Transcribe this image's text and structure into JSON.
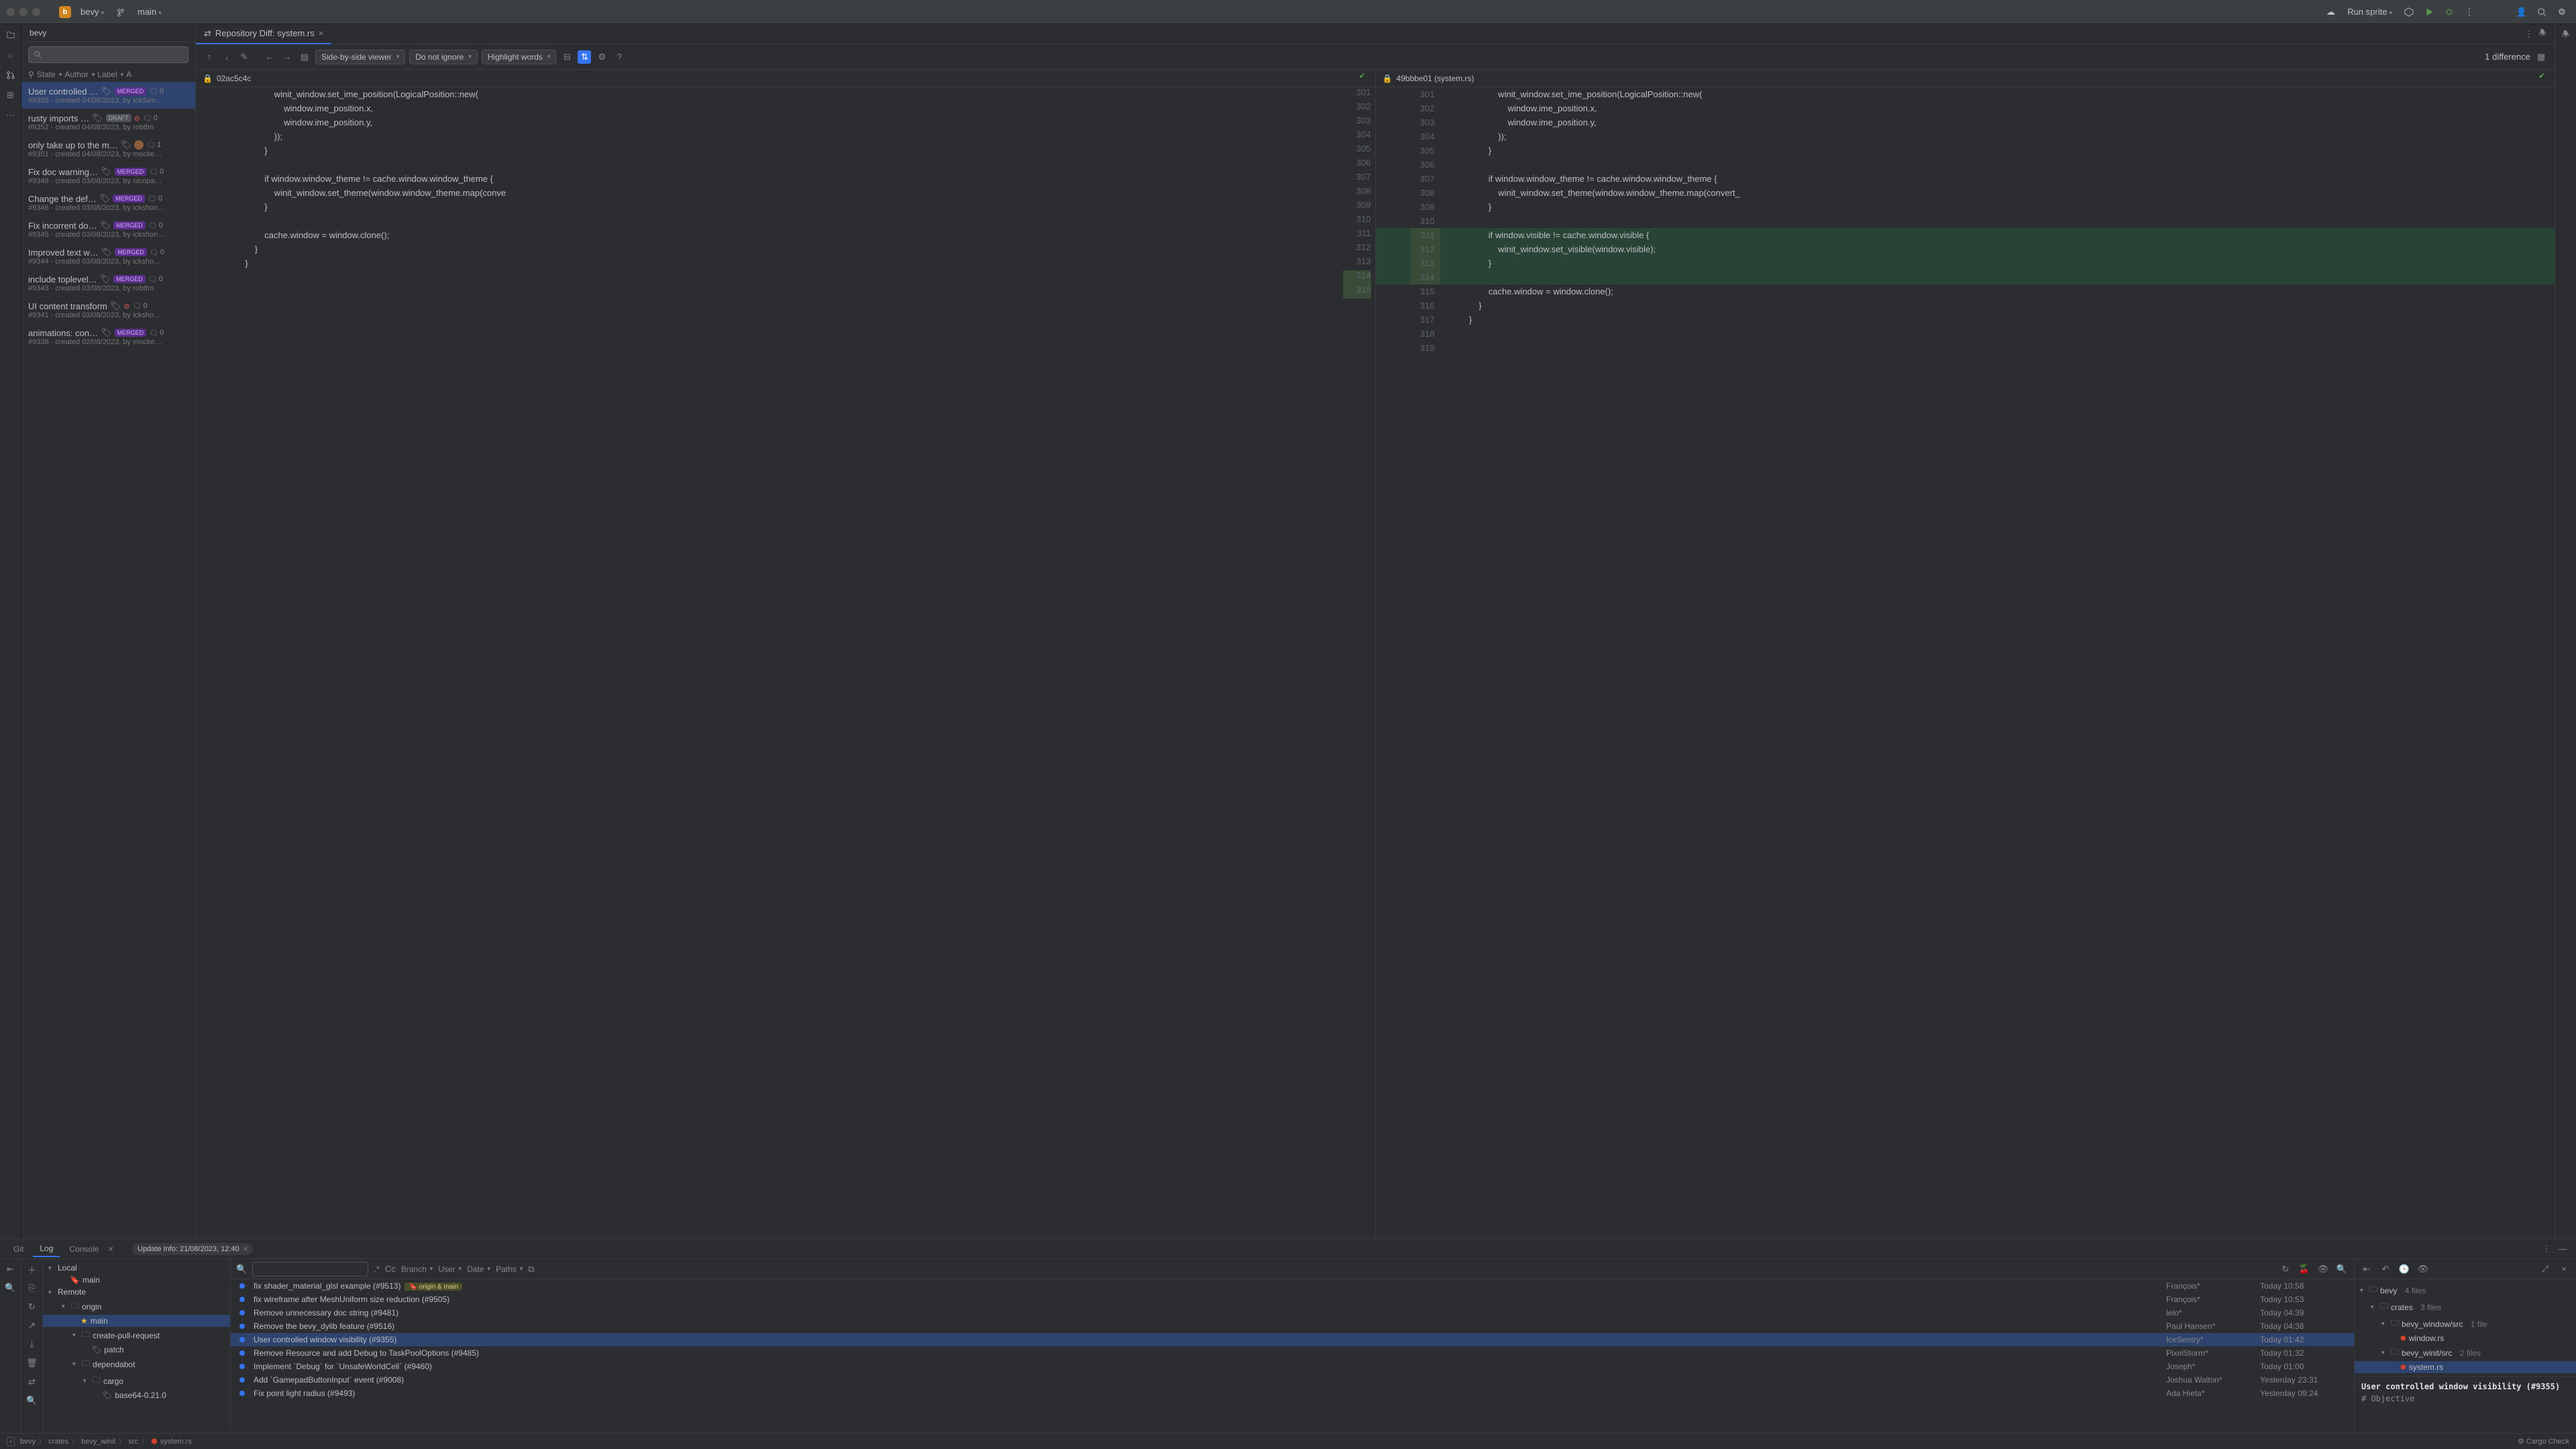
{
  "titlebar": {
    "project_initial": "b",
    "project_name": "bevy",
    "branch": "main",
    "run_config": "Run sprite"
  },
  "pr_panel": {
    "tab": "bevy",
    "search_placeholder": "",
    "filters": {
      "state": "State",
      "author": "Author",
      "label": "Label",
      "assignee": "A"
    },
    "items": [
      {
        "title": "User controlled …",
        "badge": "MERGED",
        "comments": "0",
        "meta": "#9355 · created 04/08/2023, by IceSen…",
        "sel": true
      },
      {
        "title": "rusty imports …",
        "badge": "DRAFT",
        "x": true,
        "comments": "0",
        "meta": "#9352 · created 04/08/2023, by robtfm"
      },
      {
        "title": "only take up to the m…",
        "badge": "",
        "avatar": true,
        "comments": "1",
        "meta": "#9351 · created 04/08/2023, by mocke…"
      },
      {
        "title": "Fix doc warning…",
        "badge": "MERGED",
        "comments": "0",
        "meta": "#9348 · created 03/08/2023, by nicopa…"
      },
      {
        "title": "Change the def…",
        "badge": "MERGED",
        "comments": "0",
        "meta": "#9346 · created 03/08/2023, by ickshon…"
      },
      {
        "title": "Fix incorrent do…",
        "badge": "MERGED",
        "comments": "0",
        "meta": "#9345 · created 03/08/2023, by ickshon…"
      },
      {
        "title": "Improved text w…",
        "badge": "MERGED",
        "comments": "0",
        "meta": "#9344 · created 03/08/2023, by icksho…"
      },
      {
        "title": "include toplevel…",
        "badge": "MERGED",
        "comments": "0",
        "meta": "#9343 · created 03/08/2023, by robtfm"
      },
      {
        "title": "UI content transform",
        "badge": "",
        "x": true,
        "comments": "0",
        "meta": "#9341 · created 03/08/2023, by icksho…"
      },
      {
        "title": "animations: con…",
        "badge": "MERGED",
        "comments": "0",
        "meta": "#9338 · created 02/08/2023, by mocke…"
      }
    ]
  },
  "diff": {
    "tab_title": "Repository Diff: system.rs",
    "viewer_mode": "Side-by-side viewer",
    "ignore_mode": "Do not ignore",
    "highlight_mode": "Highlight words",
    "diff_count": "1 difference",
    "left_rev": "02ac5c4c",
    "right_rev": "49bbbe01 (system.rs)",
    "left_lines": [
      {
        "n": "",
        "t": "                        winit_window.set_ime_position(LogicalPosition::new("
      },
      {
        "n": "",
        "t": "                            window.ime_position.x,"
      },
      {
        "n": "",
        "t": "                            window.ime_position.y,"
      },
      {
        "n": "",
        "t": "                        ));"
      },
      {
        "n": "",
        "t": "                    }"
      },
      {
        "n": "",
        "t": ""
      },
      {
        "n": "",
        "t": "                    if window.window_theme != cache.window.window_theme {"
      },
      {
        "n": "",
        "t": "                        winit_window.set_theme(window.window_theme.map(conve"
      },
      {
        "n": "",
        "t": "                    }"
      },
      {
        "n": "",
        "t": ""
      },
      {
        "n": "",
        "t": "                    cache.window = window.clone();"
      },
      {
        "n": "",
        "t": "                }"
      },
      {
        "n": "",
        "t": "            }"
      }
    ],
    "left_nums": [
      "301",
      "302",
      "303",
      "304",
      "305",
      "306",
      "307",
      "308",
      "309",
      "310",
      "311",
      "312",
      "313"
    ],
    "right_lines": [
      {
        "n": "301",
        "t": "                        winit_window.set_ime_position(LogicalPosition::new("
      },
      {
        "n": "302",
        "t": "                            window.ime_position.x,"
      },
      {
        "n": "303",
        "t": "                            window.ime_position.y,"
      },
      {
        "n": "304",
        "t": "                        ));"
      },
      {
        "n": "305",
        "t": "                    }"
      },
      {
        "n": "306",
        "t": ""
      },
      {
        "n": "307",
        "t": "                    if window.window_theme != cache.window.window_theme {"
      },
      {
        "n": "308",
        "t": "                        winit_window.set_theme(window.window_theme.map(convert_"
      },
      {
        "n": "309",
        "t": "                    }"
      },
      {
        "n": "310",
        "t": ""
      },
      {
        "n": "311",
        "t": "                    if window.visible != cache.window.visible {",
        "added": true
      },
      {
        "n": "312",
        "t": "                        winit_window.set_visible(window.visible);",
        "added": true
      },
      {
        "n": "313",
        "t": "                    }",
        "added": true
      },
      {
        "n": "314",
        "t": "",
        "added": true
      },
      {
        "n": "315",
        "t": "                    cache.window = window.clone();"
      },
      {
        "n": "316",
        "t": "                }"
      },
      {
        "n": "317",
        "t": "            }"
      },
      {
        "n": "318",
        "t": ""
      },
      {
        "n": "319",
        "t": ""
      }
    ],
    "extra_nums": [
      "314",
      "315"
    ]
  },
  "bottom": {
    "tabs": [
      "Git",
      "Log",
      "Console"
    ],
    "active_tab": 1,
    "update_chip": "Update Info: 21/08/2023, 12:40",
    "filters": {
      "branch": "Branch",
      "user": "User",
      "date": "Date",
      "paths": "Paths"
    },
    "regex_label": ".*",
    "cc_label": "Cc",
    "tree": {
      "local": "Local",
      "local_main": "main",
      "remote": "Remote",
      "origin": "origin",
      "origin_main": "main",
      "cpr": "create-pull-request",
      "patch": "patch",
      "dependabot": "dependabot",
      "cargo": "cargo",
      "base64": "base64-0.21.0"
    },
    "commits": [
      {
        "msg": "fix shader_material_glsl example (#9513)",
        "refs": "origin & main",
        "author": "François*",
        "date": "Today 10:58"
      },
      {
        "msg": "fix wireframe after MeshUniform size reduction (#9505)",
        "author": "François*",
        "date": "Today 10:53"
      },
      {
        "msg": "Remove unnecessary doc string (#9481)",
        "author": "lelo*",
        "date": "Today 04:39"
      },
      {
        "msg": "Remove the bevy_dylib feature (#9516)",
        "author": "Paul Hansen*",
        "date": "Today 04:38"
      },
      {
        "msg": "User controlled window visibility (#9355)",
        "author": "IceSentry*",
        "date": "Today 01:42",
        "sel": true
      },
      {
        "msg": "Remove Resource and add Debug to TaskPoolOptions (#9485)",
        "author": "PixelStorm*",
        "date": "Today 01:32"
      },
      {
        "msg": "Implement `Debug` for `UnsafeWorldCell` (#9460)",
        "author": "Joseph*",
        "date": "Today 01:00"
      },
      {
        "msg": "Add `GamepadButtonInput` event (#9008)",
        "author": "Joshua Walton*",
        "date": "Yesterday 23:31"
      },
      {
        "msg": "Fix point light radius (#9493)",
        "author": "Ada Hieta*",
        "date": "Yesterday 09:24"
      }
    ],
    "detail": {
      "root": "bevy",
      "root_n": "4 files",
      "crates": "crates",
      "crates_n": "3 files",
      "bw": "bevy_window/src",
      "bw_n": "1 file",
      "window_rs": "window.rs",
      "bwi": "bevy_winit/src",
      "bwi_n": "2 files",
      "system_rs": "system.rs",
      "commit_title": "User controlled window visibility (#9355)",
      "objective": "# Objective"
    }
  },
  "statusbar": {
    "crumbs": [
      "bevy",
      "crates",
      "bevy_winit",
      "src",
      "system.rs"
    ],
    "cargo": "Cargo Check"
  }
}
